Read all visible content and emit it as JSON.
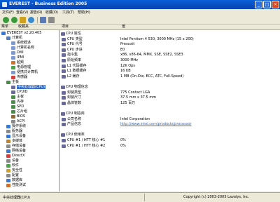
{
  "window": {
    "title": "EVEREST - Business Edition 2005",
    "minimize": "_",
    "maximize": "□",
    "close": "×"
  },
  "menu": [
    "文件(F)",
    "查看(V)",
    "报告(R)",
    "收藏(O)",
    "工具(T)",
    "帮助(H)"
  ],
  "left_header": {
    "col1": "菜单",
    "col2": "收藏夹"
  },
  "right_header": {
    "field": "项目",
    "value": "值"
  },
  "tree": [
    {
      "label": "EVEREST v2.20.405",
      "depth": 0,
      "color": "#3a78d8"
    },
    {
      "label": "计算机",
      "depth": 1,
      "color": "#5a7ab8"
    },
    {
      "label": "系统概述",
      "depth": 2,
      "color": "#7c9ad0"
    },
    {
      "label": "计算机名称",
      "depth": 2,
      "color": "#7c9ad0"
    },
    {
      "label": "DMI",
      "depth": 2,
      "color": "#7c9ad0"
    },
    {
      "label": "IPMI",
      "depth": 2,
      "color": "#7c9ad0"
    },
    {
      "label": "超频",
      "depth": 2,
      "color": "#d07030"
    },
    {
      "label": "电源管理",
      "depth": 2,
      "color": "#50a050"
    },
    {
      "label": "便携式计算机",
      "depth": 2,
      "color": "#7c9ad0"
    },
    {
      "label": "传感器",
      "depth": 2,
      "color": "#d04040"
    },
    {
      "label": "主板",
      "depth": 1,
      "color": "#4a8a4a"
    },
    {
      "label": "中央处理器(CPU)",
      "depth": 2,
      "color": "#6a6a9a",
      "selected": true
    },
    {
      "label": "CPUID",
      "depth": 2,
      "color": "#6a6a9a"
    },
    {
      "label": "主板",
      "depth": 2,
      "color": "#4a8a4a"
    },
    {
      "label": "内存",
      "depth": 2,
      "color": "#4a8a4a"
    },
    {
      "label": "SPD",
      "depth": 2,
      "color": "#4a8a4a"
    },
    {
      "label": "芯片组",
      "depth": 2,
      "color": "#4a8a4a"
    },
    {
      "label": "BIOS",
      "depth": 2,
      "color": "#8a6a3a"
    },
    {
      "label": "ACPI",
      "depth": 2,
      "color": "#8a8a8a"
    },
    {
      "label": "操作系统",
      "depth": 1,
      "color": "#3a78d8"
    },
    {
      "label": "服务器",
      "depth": 1,
      "color": "#8a8a8a"
    },
    {
      "label": "显示设备",
      "depth": 1,
      "color": "#3a78d8"
    },
    {
      "label": "多媒体",
      "depth": 1,
      "color": "#c08030"
    },
    {
      "label": "存储设备",
      "depth": 1,
      "color": "#8a8a8a"
    },
    {
      "label": "网络设备",
      "depth": 1,
      "color": "#3a78d8"
    },
    {
      "label": "DirectX",
      "depth": 1,
      "color": "#d04040"
    },
    {
      "label": "设备",
      "depth": 1,
      "color": "#8a8a8a"
    },
    {
      "label": "软件",
      "depth": 1,
      "color": "#50a050"
    },
    {
      "label": "安全性",
      "depth": 1,
      "color": "#d0a030"
    },
    {
      "label": "配置",
      "depth": 1,
      "color": "#8a8a8a"
    },
    {
      "label": "数据库",
      "depth": 1,
      "color": "#3a78d8"
    },
    {
      "label": "性能测试",
      "depth": 1,
      "color": "#d07030"
    }
  ],
  "details": [
    {
      "type": "group",
      "field": "CPU 属性",
      "color": "#6a6a9a"
    },
    {
      "type": "item",
      "field": "CPU 类型",
      "value": "Intel Pentium 4 530, 3000 MHz (15 x 200)",
      "color": "#6a6a9a"
    },
    {
      "type": "item",
      "field": "CPU 代号",
      "value": "Prescott",
      "color": "#6a6a9a"
    },
    {
      "type": "item",
      "field": "CPU 步进",
      "value": "E0",
      "color": "#6a6a9a"
    },
    {
      "type": "item",
      "field": "指令集",
      "value": "x86, x86-64, MMX, SSE, SSE2, SSE3",
      "color": "#6a6a9a"
    },
    {
      "type": "item",
      "field": "原始频率",
      "value": "3000 MHz",
      "color": "#6a6a9a"
    },
    {
      "type": "item",
      "field": "L1 代码缓存",
      "value": "12K Ops",
      "color": "#6a6a9a"
    },
    {
      "type": "item",
      "field": "L1 数据缓存",
      "value": "16 KB",
      "color": "#6a6a9a"
    },
    {
      "type": "item",
      "field": "L2 缓存",
      "value": "1 MB (On-Die, ECC, ATC, Full-Speed)",
      "color": "#6a6a9a"
    },
    {
      "type": "blank"
    },
    {
      "type": "group",
      "field": "CPU 物理信息",
      "color": "#6a6a9a"
    },
    {
      "type": "item",
      "field": "封装类型",
      "value": "775 Contact LGA",
      "color": "#6a6a9a"
    },
    {
      "type": "item",
      "field": "封装尺寸",
      "value": "37.5 mm x 37.5 mm",
      "color": "#6a6a9a"
    },
    {
      "type": "item",
      "field": "晶体管数",
      "value": "125 百万",
      "color": "#6a6a9a"
    },
    {
      "type": "blank"
    },
    {
      "type": "group",
      "field": "CPU 制造商",
      "color": "#6a6a9a"
    },
    {
      "type": "item",
      "field": "公司名称",
      "value": "Intel Corporation",
      "color": "#6a6a9a"
    },
    {
      "type": "item",
      "field": "产品信息",
      "value": "http://www.intel.com/products/processor",
      "link": true,
      "color": "#6a6a9a"
    },
    {
      "type": "blank"
    },
    {
      "type": "group",
      "field": "CPU 使用率",
      "color": "#6a6a9a"
    },
    {
      "type": "item",
      "field": "CPU #1 / HTT 核心 #1",
      "value": "0%",
      "color": "#6a6a9a"
    },
    {
      "type": "item",
      "field": "CPU #1 / HTT 核心 #2",
      "value": "0%",
      "color": "#6a6a9a"
    }
  ],
  "status": {
    "left": "中央处理器(CPU)",
    "right": "Copyright (c) 2003-2005 Lavalys, Inc."
  }
}
